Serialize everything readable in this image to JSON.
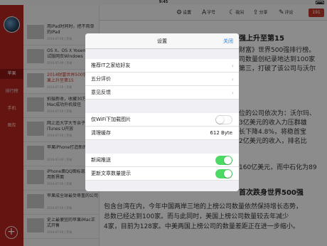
{
  "status_bar": {
    "time": "9:45"
  },
  "sidebar": {
    "nav": [
      {
        "label": "苹果"
      },
      {
        "label": "排行榜"
      },
      {
        "label": "手机"
      },
      {
        "label": "图库"
      }
    ],
    "add_label": "+"
  },
  "toolbar": {
    "settings": "设置",
    "font_size": "字号",
    "night": "夜间",
    "share": "分享",
    "comment": "评论",
    "comment_count": "191"
  },
  "articles": [
    {
      "title": "用iPad时同时，把不简单的iPad",
      "meta": "2014-07-09 | 苹果"
    },
    {
      "title": "OS X、OS X Yosemite 测试版网页Windows",
      "meta": "2014-07-09 | 苹果"
    },
    {
      "title": "2014财富世界500强：苹果上升至第15",
      "meta": "2014-07-09 | 苹果"
    },
    {
      "title": "拍摄新收，收藏30万份Mac成功外机接任",
      "meta": "2014-07-09 | 苹果"
    },
    {
      "title": "网上追大学大专亲子iTunes U开放",
      "meta": "2014-07-09 | 苹果"
    },
    {
      "title": "苹果iPhone打造新的底片",
      "meta": "2014-07-09 | 苹果"
    },
    {
      "title": "iPhone面QQ图标现增强现用新界面",
      "meta": "2014-07-09 | 苹果"
    },
    {
      "title": "苹果成全球最受尊重的公司",
      "meta": "2014-07-09 | 苹果"
    },
    {
      "title": "史上最便宜的苹果iMac正式开售",
      "meta": "2014-07-09 | 苹果"
    }
  ],
  "article": {
    "lines": [
      "强上升至第15",
      "财富》世界500强排行榜。",
      "司数量创纪录地达到100家",
      "第三，打破了该公司与沃尔",
      "位的公司依次为：沃尔玛、",
      "3亿美元的收入力压群雄",
      "长下降4.8%，将稳首宝",
      "2亿美元的收入，排名比",
      "160亿美元，而中石化为89",
      "首次跌身世界500强",
      "包含台湾在内，今年中国两岸三地的上榜公司数量依然保持增长态势，",
      "总数已经达到100家。而与此同时，美国上榜公司数量较去年减少",
      "4家，目前为128家。中美两国上榜公司的数量差距正在进一步缩小。"
    ]
  },
  "settings_modal": {
    "title": "设置",
    "close": "关闭",
    "rows": {
      "recommend": "推荐IT之家给好友",
      "rate": "五分评价",
      "feedback": "意见反馈",
      "wifi_images": "仅WiFi下加载图片",
      "clear_cache": "清理缓存",
      "cache_size": "612 Byte",
      "news_push": "新闻推送",
      "update_count": "更新文章数量提示"
    },
    "toggles": {
      "wifi_images": false,
      "news_push": true,
      "update_count": true
    },
    "accent": "#4cd964"
  }
}
